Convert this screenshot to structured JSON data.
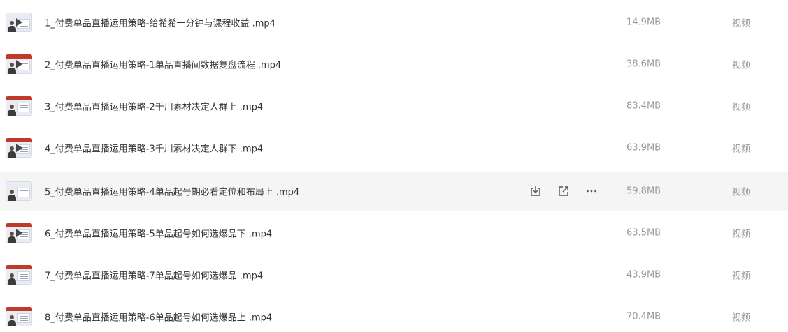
{
  "files": [
    {
      "name": "1_付费单品直播运用策略-给希希一分钟与课程收益 .mp4",
      "size": "14.9MB",
      "type": "视频",
      "thumb": {
        "bar": false,
        "play": true
      }
    },
    {
      "name": "2_付费单品直播运用策略-1单品直播间数据复盘流程 .mp4",
      "size": "38.6MB",
      "type": "视频",
      "thumb": {
        "bar": true,
        "play": true
      }
    },
    {
      "name": "3_付费单品直播运用策略-2千川素材决定人群上 .mp4",
      "size": "83.4MB",
      "type": "视频",
      "thumb": {
        "bar": true,
        "play": false
      }
    },
    {
      "name": "4_付费单品直播运用策略-3千川素材决定人群下 .mp4",
      "size": "63.9MB",
      "type": "视频",
      "thumb": {
        "bar": true,
        "play": true
      }
    },
    {
      "name": "5_付费单品直播运用策略-4单品起号期必看定位和布局上 .mp4",
      "size": "59.8MB",
      "type": "视频",
      "thumb": {
        "bar": false,
        "play": false
      },
      "hovered": true
    },
    {
      "name": "6_付费单品直播运用策略-5单品起号如何选爆品下 .mp4",
      "size": "63.5MB",
      "type": "视频",
      "thumb": {
        "bar": true,
        "play": true
      }
    },
    {
      "name": "7_付费单品直播运用策略-7单品起号如何选爆品 .mp4",
      "size": "43.9MB",
      "type": "视频",
      "thumb": {
        "bar": true,
        "play": false
      }
    },
    {
      "name": "8_付费单品直播运用策略-6单品起号如何选爆品上 .mp4",
      "size": "70.4MB",
      "type": "视频",
      "thumb": {
        "bar": true,
        "play": false
      }
    }
  ],
  "row_actions": [
    {
      "icon": "download-icon"
    },
    {
      "icon": "share-icon"
    },
    {
      "icon": "more-icon"
    }
  ],
  "colors": {
    "name_text": "#333333",
    "meta_text": "#999999",
    "hover_bg": "#f5f5f5",
    "icon": "#555555"
  }
}
